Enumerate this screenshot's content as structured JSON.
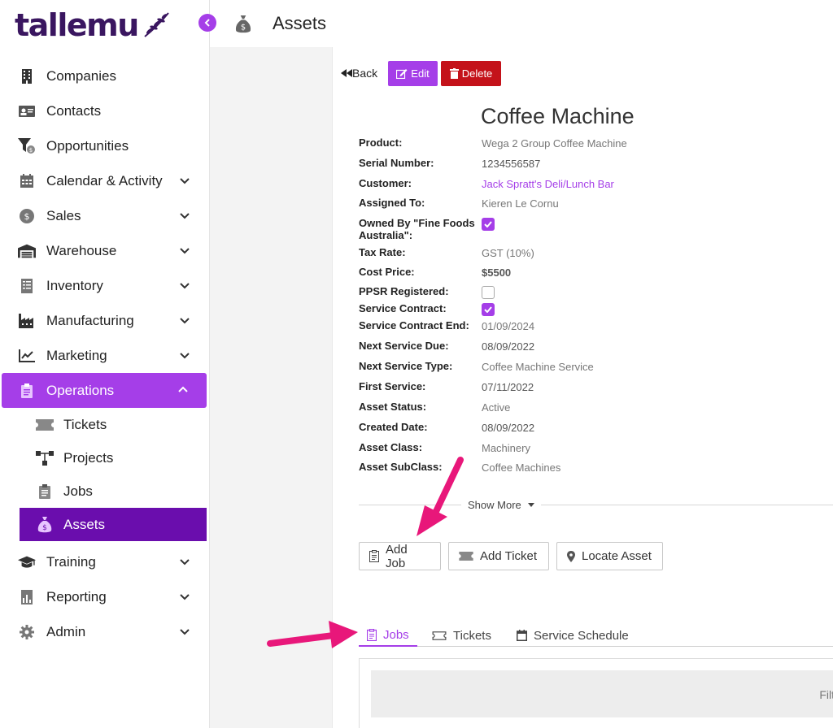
{
  "app": {
    "logo_text": "tallemu",
    "page_title": "Assets"
  },
  "sidebar": {
    "items": [
      {
        "label": "Companies",
        "icon": "building-icon"
      },
      {
        "label": "Contacts",
        "icon": "contact-card-icon"
      },
      {
        "label": "Opportunities",
        "icon": "funnel-icon"
      },
      {
        "label": "Calendar & Activity",
        "icon": "calendar-icon"
      },
      {
        "label": "Sales",
        "icon": "dollar-coin-icon"
      },
      {
        "label": "Warehouse",
        "icon": "warehouse-icon"
      },
      {
        "label": "Inventory",
        "icon": "inventory-icon"
      },
      {
        "label": "Manufacturing",
        "icon": "factory-icon"
      },
      {
        "label": "Marketing",
        "icon": "chart-line-icon"
      },
      {
        "label": "Operations",
        "icon": "clipboard-icon"
      }
    ],
    "sub_items": [
      {
        "label": "Tickets",
        "icon": "ticket-icon"
      },
      {
        "label": "Projects",
        "icon": "project-tree-icon"
      },
      {
        "label": "Jobs",
        "icon": "clipboard-list-icon"
      },
      {
        "label": "Assets",
        "icon": "money-bag-icon"
      }
    ],
    "bottom_items": [
      {
        "label": "Training",
        "icon": "graduation-cap-icon"
      },
      {
        "label": "Reporting",
        "icon": "report-icon"
      },
      {
        "label": "Admin",
        "icon": "gear-icon"
      }
    ]
  },
  "actions": {
    "back": "Back",
    "edit": "Edit",
    "delete": "Delete"
  },
  "record": {
    "title": "Coffee Machine",
    "fields": [
      {
        "label": "Product:",
        "value": "Wega 2 Group Coffee Machine"
      },
      {
        "label": "Serial Number:",
        "value": "1234556587"
      },
      {
        "label": "Customer:",
        "value": "Jack Spratt's Deli/Lunch Bar"
      },
      {
        "label": "Assigned To:",
        "value": "Kieren Le Cornu"
      },
      {
        "label": "Owned By \"Fine Foods Australia\":",
        "value": "checked"
      },
      {
        "label": "Tax Rate:",
        "value": "GST (10%)"
      },
      {
        "label": "Cost Price:",
        "value": "$5500"
      },
      {
        "label": "PPSR Registered:",
        "value": "unchecked"
      },
      {
        "label": "Service Contract:",
        "value": "checked"
      },
      {
        "label": "Service Contract End:",
        "value": "01/09/2024"
      },
      {
        "label": "Next Service Due:",
        "value": "08/09/2022"
      },
      {
        "label": "Next Service Type:",
        "value": "Coffee Machine Service"
      },
      {
        "label": "First Service:",
        "value": "07/11/2022"
      },
      {
        "label": "Asset Status:",
        "value": "Active"
      },
      {
        "label": "Created Date:",
        "value": "08/09/2022"
      },
      {
        "label": "Asset Class:",
        "value": "Machinery"
      },
      {
        "label": "Asset SubClass:",
        "value": "Coffee Machines"
      }
    ],
    "show_more": "Show More"
  },
  "buttons": {
    "add_job": "Add Job",
    "add_ticket": "Add Ticket",
    "locate_asset": "Locate Asset"
  },
  "tabs": [
    {
      "label": "Jobs",
      "active": true
    },
    {
      "label": "Tickets",
      "active": false
    },
    {
      "label": "Service Schedule",
      "active": false
    }
  ],
  "list": {
    "filter_text": "Filt"
  },
  "colors": {
    "accent": "#a53ee8",
    "active_sub": "#6a0dad",
    "danger": "#c4121a",
    "annotation_arrow": "#e8177a"
  }
}
